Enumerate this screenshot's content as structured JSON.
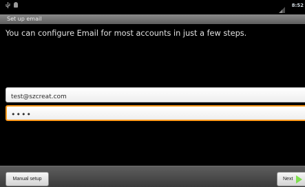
{
  "status_bar": {
    "left_icons": [
      "usb-icon",
      "android-debug-icon"
    ],
    "time": "8:52"
  },
  "title": "Set up email",
  "intro": "You can configure Email for most accounts in just a few steps.",
  "email_field": {
    "value": "test@szcreat.com",
    "placeholder": ""
  },
  "password_field": {
    "value": "test",
    "placeholder": ""
  },
  "buttons": {
    "manual_setup": "Manual setup",
    "next": "Next"
  },
  "colors": {
    "focus_border": "#ff9a1a",
    "next_arrow": "#7ee04e",
    "background": "#000000"
  }
}
